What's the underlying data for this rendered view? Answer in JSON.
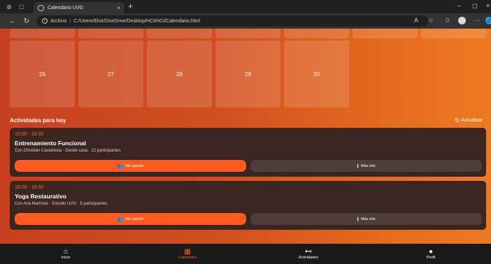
{
  "browser": {
    "tab_title": "Calendario UVG",
    "tab_close": "×",
    "new_tab": "+",
    "address_label": "Archivo",
    "address_sep": "|",
    "address_url": "C:/Users/Elvir/OneDrive/Desktop/HCI/HCI/Calendario.html",
    "minimize": "–",
    "maximize": "◻",
    "close": "×"
  },
  "calendar": {
    "days": [
      "26",
      "27",
      "28",
      "29",
      "30"
    ]
  },
  "activities": {
    "title": "Actividades para hoy",
    "refresh_label": "Actualizar",
    "items": [
      {
        "time": "15:00 - 16:30",
        "title": "Entrenamiento Funcional",
        "meta": "Con Christian Castañeda · Desde casa · 12 participantes",
        "join_label": "Me apunto",
        "info_label": "Más info"
      },
      {
        "time": "18:00 - 19:30",
        "title": "Yoga Restaurativo",
        "meta": "Con Ana Martínez · Estudio UVG · 8 participantes",
        "join_label": "Me apunto",
        "info_label": "Más info"
      }
    ]
  },
  "bottom_nav": {
    "items": [
      {
        "label": "Inicio",
        "icon": "home-icon"
      },
      {
        "label": "Calendario",
        "icon": "calendar-icon",
        "active": true
      },
      {
        "label": "Actividades",
        "icon": "dumbbell-icon"
      },
      {
        "label": "Perfil",
        "icon": "user-icon"
      }
    ]
  },
  "colors": {
    "accent": "#ff5a1f",
    "card_bg": "#3a2521",
    "nav_bg": "#1a1a1a"
  }
}
